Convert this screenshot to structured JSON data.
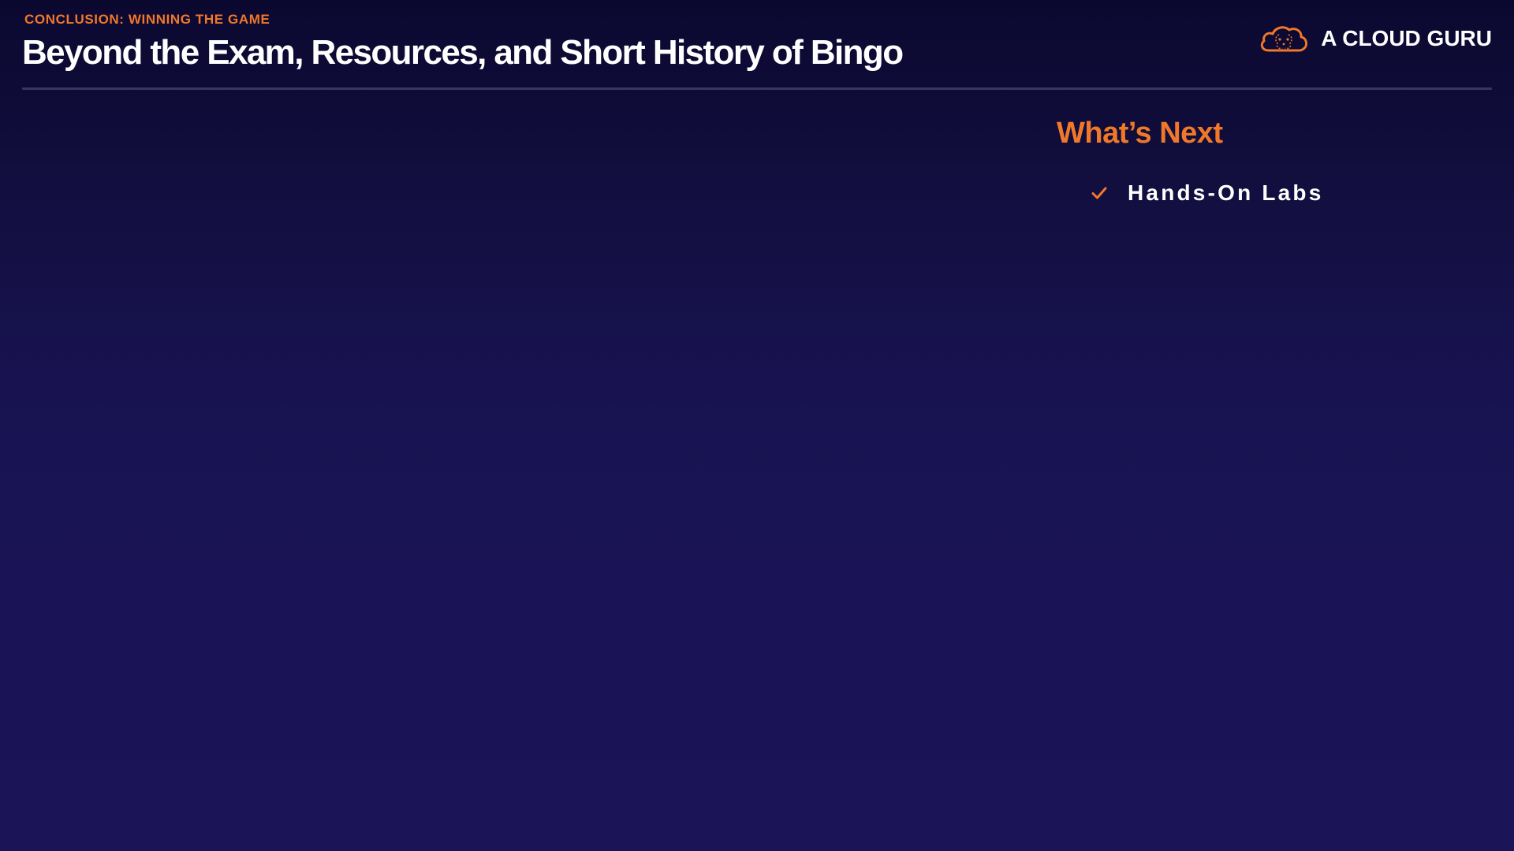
{
  "header": {
    "eyebrow": "CONCLUSION: WINNING THE GAME",
    "title": "Beyond the Exam, Resources, and Short History of Bingo"
  },
  "brand": {
    "name": "A CLOUD GURU",
    "icon": "cloud-brain-icon"
  },
  "whats_next": {
    "heading": "What’s Next",
    "items": [
      {
        "label": "Hands-On Labs",
        "icon": "check-icon"
      }
    ]
  },
  "colors": {
    "accent": "#f0782a",
    "background_top": "#0b0830",
    "background_bottom": "#1b1557",
    "text": "#ffffff",
    "divider": "#3a3465"
  }
}
